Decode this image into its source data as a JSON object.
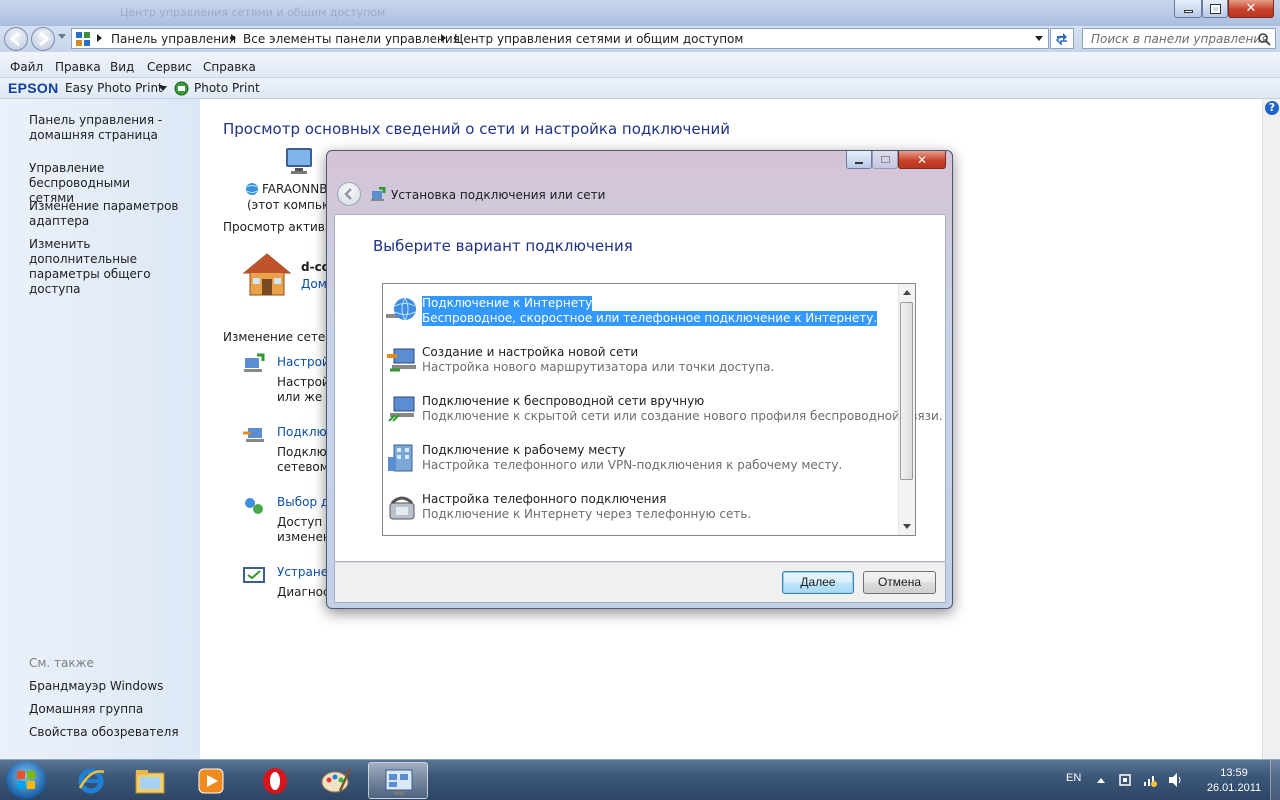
{
  "window": {
    "title": "Центр управления сетями и общим доступом"
  },
  "address": {
    "crumbs": [
      "Панель управления",
      "Все элементы панели управления",
      "Центр управления сетями и общим доступом"
    ],
    "search_placeholder": "Поиск в панели управления"
  },
  "menu": [
    "Файл",
    "Правка",
    "Вид",
    "Сервис",
    "Справка"
  ],
  "epson": {
    "brand": "EPSON",
    "easy_photo_print": "Easy Photo Print",
    "photo_print": "Photo Print"
  },
  "sidebar": {
    "home": [
      "Панель управления -",
      "домашняя страница"
    ],
    "items": [
      [
        "Управление беспроводными",
        "сетями"
      ],
      [
        "Изменение параметров",
        "адаптера"
      ],
      [
        "Изменить дополнительные",
        "параметры общего доступа"
      ]
    ],
    "see_also_label": "См. также",
    "see_also": [
      "Брандмауэр Windows",
      "Домашняя группа",
      "Свойства обозревателя"
    ]
  },
  "main": {
    "heading": "Просмотр основных сведений о сети и настройка подключений",
    "computer_name": "FARAONNB",
    "computer_sub": "(этот компьют",
    "active_networks_label": "Просмотр активн",
    "network_name": "d-co",
    "network_type": "Дом",
    "change_label": "Изменение сетевы",
    "tasks": [
      {
        "link": "Настрой",
        "desc": [
          "Настрой",
          "или же н"
        ]
      },
      {
        "link": "Подклю",
        "desc": [
          "Подклю",
          "сетевому"
        ]
      },
      {
        "link": "Выбор до",
        "desc": [
          "Доступ к",
          "изменен"
        ]
      },
      {
        "link": "Устранен",
        "desc": [
          "Диагност"
        ]
      }
    ]
  },
  "dialog": {
    "title": "Установка подключения или сети",
    "heading": "Выберите вариант подключения",
    "options": [
      {
        "title": "Подключение к Интернету",
        "desc": "Беспроводное, скоростное или телефонное подключение к Интернету.",
        "icon": "globe-icon",
        "selected": true
      },
      {
        "title": "Создание и настройка новой сети",
        "desc": "Настройка нового маршрутизатора или точки доступа.",
        "icon": "new-network-icon",
        "selected": false
      },
      {
        "title": "Подключение к беспроводной сети вручную",
        "desc": "Подключение к скрытой сети или создание нового профиля беспроводной связи.",
        "icon": "wireless-network-icon",
        "selected": false
      },
      {
        "title": "Подключение к рабочему месту",
        "desc": "Настройка телефонного или VPN-подключения к рабочему месту.",
        "icon": "workplace-icon",
        "selected": false
      },
      {
        "title": "Настройка телефонного подключения",
        "desc": "Подключение к Интернету через телефонную сеть.",
        "icon": "dialup-phone-icon",
        "selected": false
      }
    ],
    "next_label": "Далее",
    "cancel_label": "Отмена"
  },
  "taskbar": {
    "lang": "EN",
    "time": "13:59",
    "date": "26.01.2011"
  }
}
